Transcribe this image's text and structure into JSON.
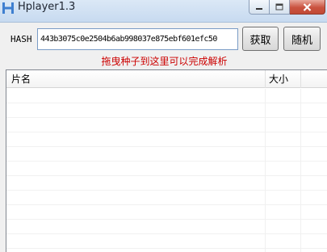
{
  "window": {
    "title": "Hplayer1.3",
    "icon": "hplayer-app-icon",
    "controls": [
      "minimize-icon",
      "maximize-icon",
      "close-icon"
    ]
  },
  "hash": {
    "label": "HASH",
    "value": "443b3075c0e2504b6ab998037e875ebf601efc50"
  },
  "buttons": {
    "fetch_label": "获取",
    "random_label": "随机"
  },
  "hint": "拖曳种子到这里可以完成解析",
  "list": {
    "columns": [
      "片名",
      "大小"
    ],
    "rows": []
  },
  "colors": {
    "hint": "#cc0000",
    "titlebar": "#c7daf0",
    "close_button": "#c9523f"
  }
}
